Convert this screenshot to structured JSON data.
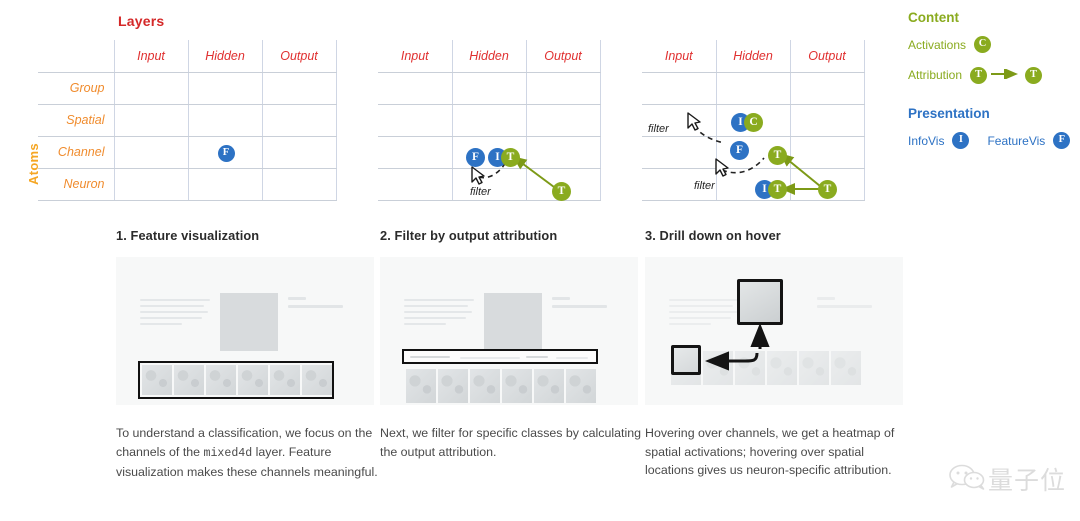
{
  "diagram": {
    "layers_title": "Layers",
    "atoms_title": "Atoms",
    "columns": [
      "Input",
      "Hidden",
      "Output"
    ],
    "rows": [
      "Group",
      "Spatial",
      "Channel",
      "Neuron"
    ],
    "filter_label": "filter",
    "badges": {
      "featurevis": "F",
      "infovis": "I",
      "attribution": "T",
      "activations": "C"
    },
    "grids": [
      {
        "name": "grid-feature-visualization",
        "markers": [
          {
            "badge": "F",
            "color": "blue",
            "row": "Channel",
            "col": "Hidden"
          }
        ]
      },
      {
        "name": "grid-filter-by-output-attribution",
        "markers": [
          {
            "badge": "F",
            "color": "blue",
            "row": "Channel",
            "col": "Hidden"
          },
          {
            "badge": "I",
            "color": "blue",
            "row": "Channel",
            "col": "Hidden"
          },
          {
            "badge": "T",
            "color": "green",
            "row": "Channel",
            "col": "Hidden"
          },
          {
            "badge": "T",
            "color": "green",
            "row": "Neuron",
            "col": "Output"
          }
        ]
      },
      {
        "name": "grid-drill-down-on-hover",
        "markers": [
          {
            "badge": "I",
            "color": "blue",
            "row": "Spatial",
            "col": "Hidden"
          },
          {
            "badge": "C",
            "color": "green",
            "row": "Spatial",
            "col": "Hidden"
          },
          {
            "badge": "F",
            "color": "blue",
            "row": "Channel",
            "col": "Hidden"
          },
          {
            "badge": "T",
            "color": "green",
            "row": "Channel",
            "col": "Output"
          },
          {
            "badge": "I",
            "color": "blue",
            "row": "Neuron",
            "col": "Output"
          },
          {
            "badge": "T",
            "color": "green",
            "row": "Neuron",
            "col": "Output"
          },
          {
            "badge": "T",
            "color": "green",
            "row": "Neuron",
            "col": "Output"
          }
        ]
      }
    ]
  },
  "legend": {
    "content_heading": "Content",
    "presentation_heading": "Presentation",
    "activations_label": "Activations",
    "activations_badge": "C",
    "attribution_label": "Attribution",
    "attribution_badge_from": "T",
    "attribution_badge_to": "T",
    "infovis_label": "InfoVis",
    "infovis_badge": "I",
    "featurevis_label": "FeatureVis",
    "featurevis_badge": "F"
  },
  "panels": [
    {
      "title": "1. Feature visualization",
      "text_parts": {
        "before": "To understand a classification, we focus on the channels of the ",
        "code": "mixed4d",
        "after": " layer. Feature visualization makes these channels meaningful."
      }
    },
    {
      "title": "2. Filter by output attribution",
      "text_parts": {
        "before": "Next, we filter for specific classes by calculating the output attribution.",
        "code": "",
        "after": ""
      }
    },
    {
      "title": "3. Drill down on hover",
      "text_parts": {
        "before": "Hovering over channels, we get a heatmap of spatial activations; hovering over spatial locations gives us neuron-specific attribution.",
        "code": "",
        "after": ""
      }
    }
  ],
  "watermark": {
    "text": "量子位"
  },
  "colors": {
    "red": "#e03030",
    "orange": "#f08c2e",
    "blue": "#2d72c4",
    "green": "#8aab1f",
    "olive": "#7d9a17"
  }
}
